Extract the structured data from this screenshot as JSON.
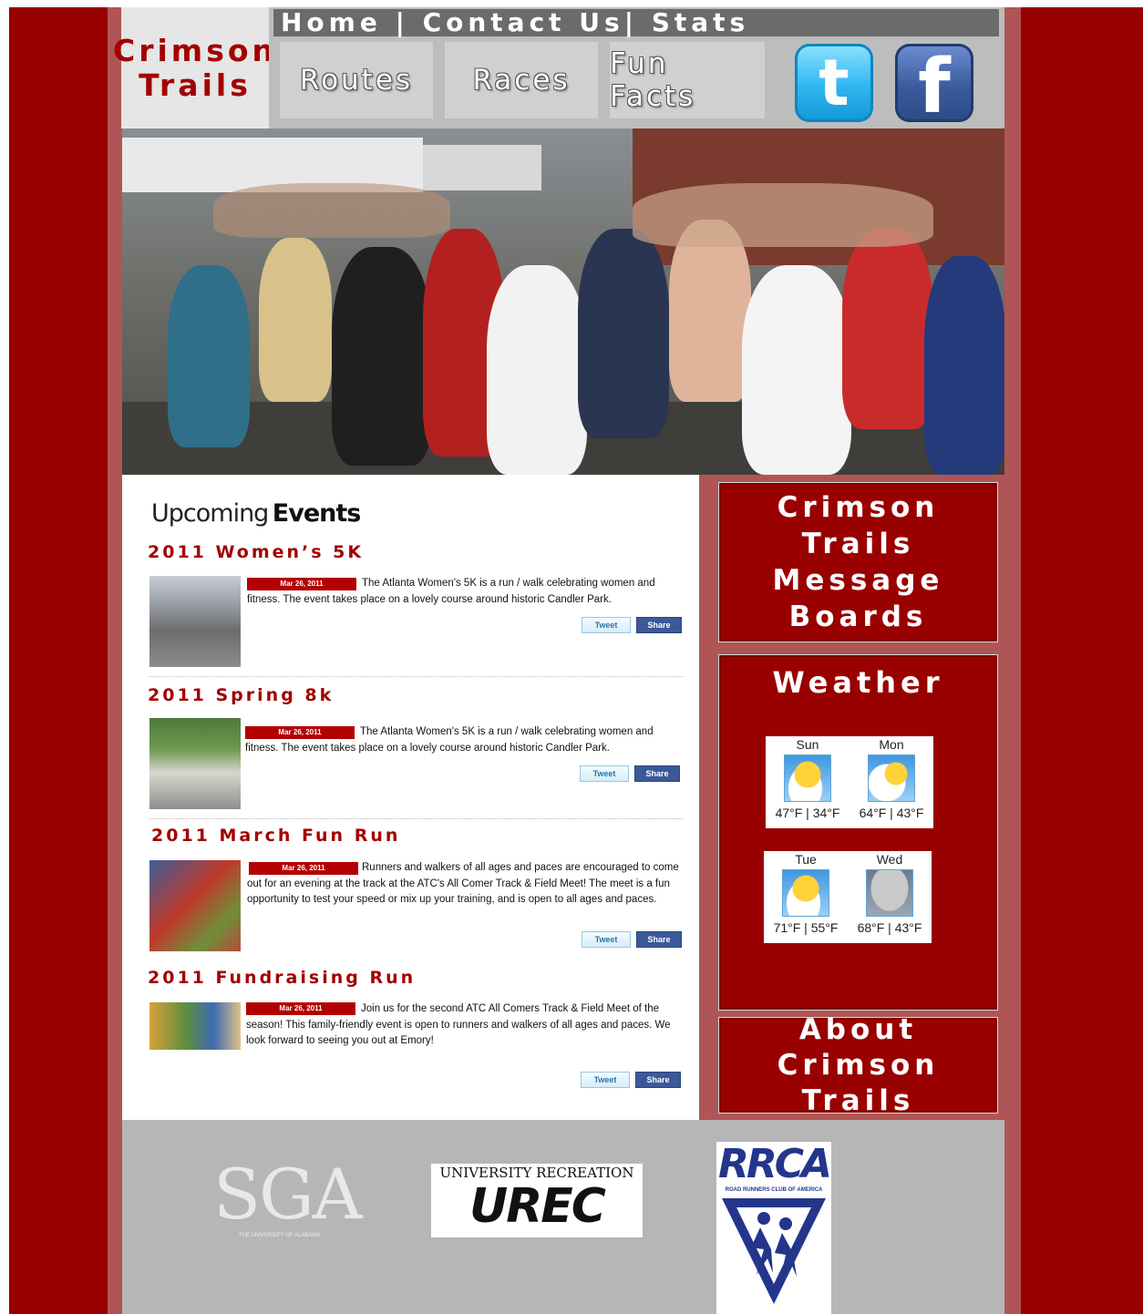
{
  "site": {
    "logo_line1": "Crimson",
    "logo_line2": "Trails"
  },
  "topnav": {
    "home": "Home",
    "sep1": " | ",
    "contact": "Contact Us",
    "sep2": "| ",
    "stats": "Stats"
  },
  "nav": {
    "routes": "Routes",
    "races": "Races",
    "fun_facts": "Fun Facts"
  },
  "social": {
    "twitter_glyph": "t",
    "facebook_glyph": "f"
  },
  "events": {
    "title_light": "Upcoming",
    "title_bold": "Events",
    "tweet_label": "Tweet",
    "share_label": "Share",
    "items": [
      {
        "name": "2011 Women’s 5K",
        "date": "Mar 26, 2011",
        "text": "The Atlanta Women's 5K is a run / walk celebrating women and fitness. The event takes place on a lovely course around historic Candler Park."
      },
      {
        "name": "2011 Spring 8k",
        "date": "Mar 26, 2011",
        "text": "The Atlanta Women's 5K is a run / walk celebrating women and fitness. The event takes place on a lovely course around historic Candler Park."
      },
      {
        "name": "2011 March Fun Run",
        "date": "Mar 26, 2011",
        "text": "Runners and walkers of all ages and paces are encouraged to come out for an evening at the track at the ATC's All Comer Track & Field Meet! The meet is a fun opportunity to test your speed or mix up your training, and is open to all ages and paces."
      },
      {
        "name": "2011 Fundraising Run",
        "date": "Mar 26, 2011",
        "text": "Join us for the second ATC All Comers Track & Field Meet of the season! This family-friendly event is open to runners and walkers of all ages and paces. We look forward to seeing you out at Emory!"
      }
    ]
  },
  "sidebar": {
    "message_boards": "Crimson Trails Message Boards",
    "weather_title": "Weather",
    "about": "About Crimson Trails"
  },
  "weather": [
    {
      "day": "Sun",
      "temps": "47°F | 34°F",
      "icon": "partly-sunny-icon"
    },
    {
      "day": "Mon",
      "temps": "64°F | 43°F",
      "icon": "partly-sunny-icon"
    },
    {
      "day": "Tue",
      "temps": "71°F | 55°F",
      "icon": "partly-sunny-icon"
    },
    {
      "day": "Wed",
      "temps": "68°F | 43°F",
      "icon": "thunderstorm-icon"
    }
  ],
  "sponsors": {
    "sga": "SGA",
    "sga_sub": "THE UNIVERSITY OF ALABAMA",
    "urec_top": "UNIVERSITY RECREATION",
    "urec": "UREC",
    "rrca": "RRCA",
    "rrca_sub": "ROAD RUNNERS CLUB OF AMERICA"
  }
}
